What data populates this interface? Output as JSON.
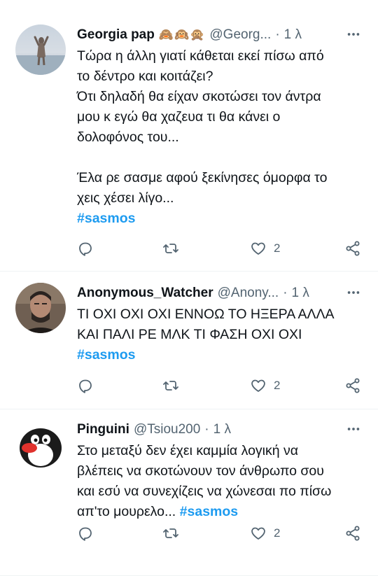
{
  "tweets": [
    {
      "name": "Georgia pap",
      "emojis": "🙈🙉🙊",
      "handle": "@Georg...",
      "dot": "·",
      "time": "1 λ",
      "lines": [
        "Τώρα η άλλη γιατί κάθεται εκεί πίσω από",
        "το δέντρο και κοιτάζει?",
        "Ότι δηλαδή θα είχαν σκοτώσει τον άντρα",
        "μου κ εγώ θα χαζευα τι θα κάνει ο",
        "δολοφόνος του...",
        "",
        "Έλα ρε σασμε αφού ξεκίνησες όμορφα το",
        "χεις χέσει λίγο..."
      ],
      "hashtag": "#sasmos",
      "likes": "2"
    },
    {
      "name": "Anonymous_Watcher",
      "handle": "@Anony...",
      "dot": "·",
      "time": "1 λ",
      "lines": [
        "ΤΙ ΟΧΙ ΟΧΙ ΟΧΙ ΕΝΝΟΩ ΤΟ ΗΞΕΡΑ ΑΛΛΑ",
        "ΚΑΙ ΠΑΛΙ ΡΕ ΜΛΚ ΤΙ ΦΑΣΗ ΟΧΙ ΟΧΙ"
      ],
      "hashtag": "#sasmos",
      "likes": "2"
    },
    {
      "name": "Pinguini",
      "handle": "@Tsiou200",
      "dot": "·",
      "time": "1 λ",
      "lines": [
        "Στο μεταξύ δεν έχει καμμία λογική να",
        "βλέπεις να σκοτώνουν τον άνθρωπο σου",
        "και εσύ να συνεχίζεις να χώνεσαι πο πίσω"
      ],
      "last_line": "απ'το μουρελο...",
      "hashtag": "#sasmos",
      "likes": "2"
    }
  ],
  "icons": {
    "reply": "reply-icon",
    "retweet": "retweet-icon",
    "like": "heart-icon",
    "share": "share-icon",
    "more": "more-options-icon"
  },
  "colors": {
    "accent": "#1d9bf0",
    "muted": "#536471",
    "text": "#0f1419",
    "divider": "#eff3f4"
  }
}
